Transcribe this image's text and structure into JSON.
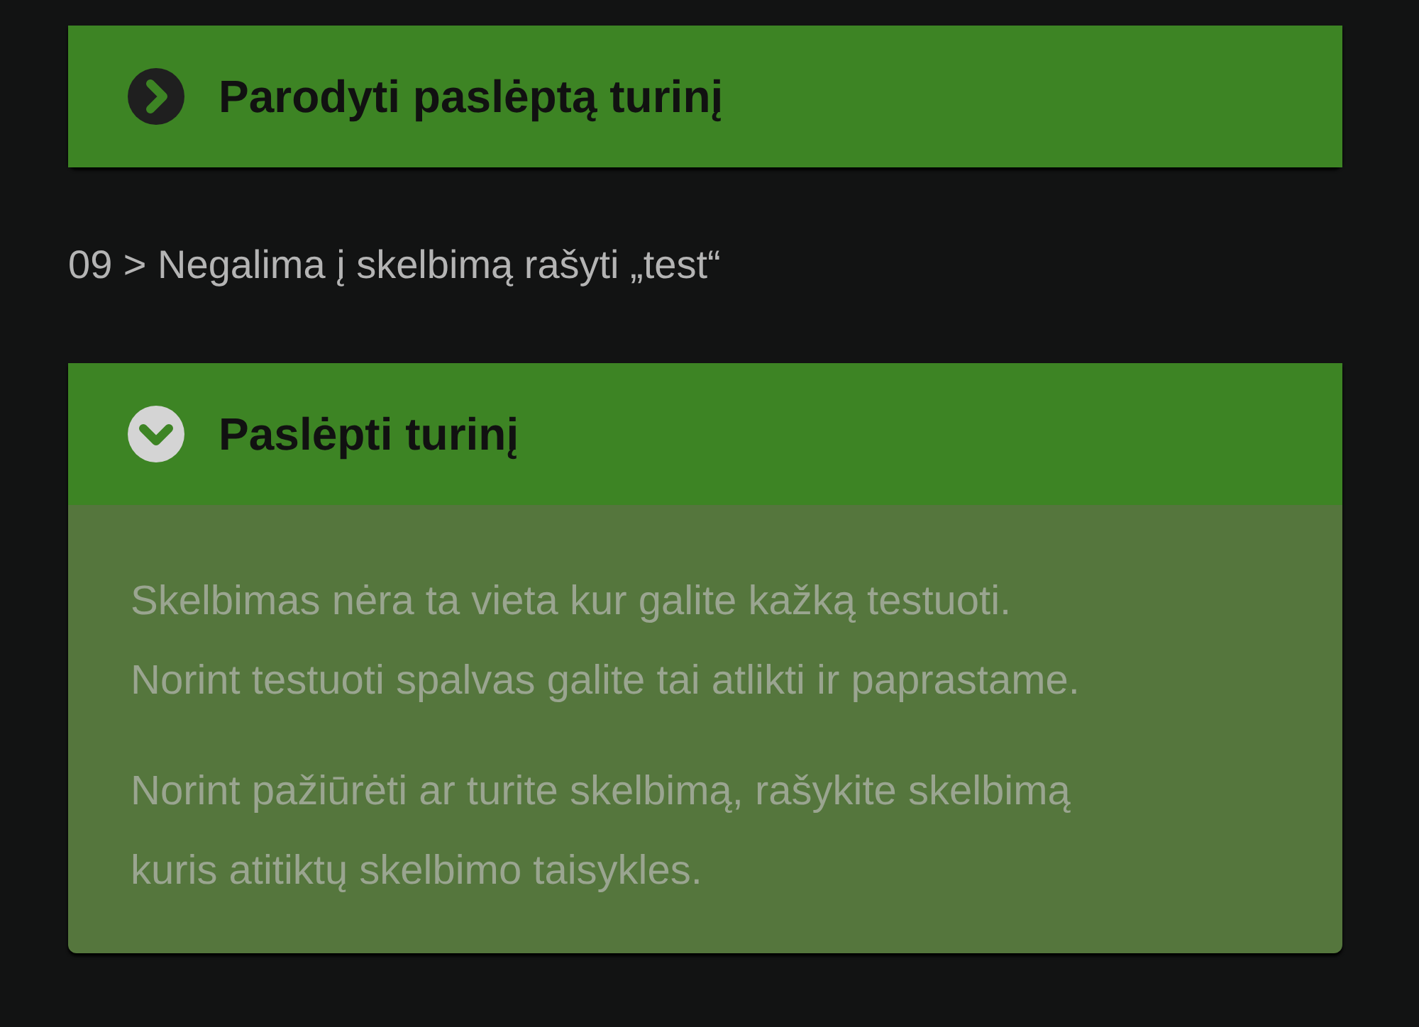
{
  "items": [
    {
      "kind": "toggle",
      "label": "Parodyti paslėptą turinį",
      "expanded": false
    },
    {
      "kind": "heading",
      "text": "09 > Negalima į skelbimą rašyti „test“"
    },
    {
      "kind": "toggle",
      "label": "Paslėpti turinį",
      "expanded": true,
      "paragraphs": [
        [
          "Skelbimas nėra ta vieta kur galite kažką testuoti.",
          "Norint testuoti spalvas galite tai atlikti ir paprastame."
        ],
        [
          "Norint pažiūrėti ar turite skelbimą, rašykite skelbimą",
          "kuris atitiktų skelbimo taisykles."
        ]
      ]
    }
  ]
}
